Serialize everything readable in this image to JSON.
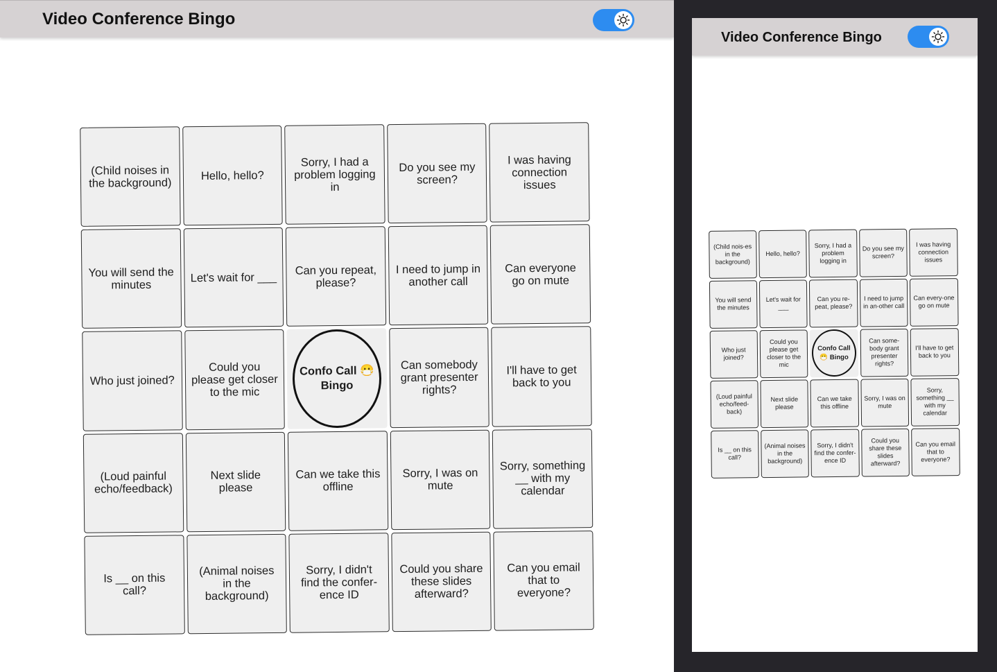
{
  "desktop": {
    "title": "Video Conference Bingo",
    "cells": [
      "(Child noises in the background)",
      "Hello, hello?",
      "Sorry, I had a problem logging in",
      "Do you see my screen?",
      "I was having connection issues",
      "You will send the minutes",
      "Let's wait for ___",
      "Can you repeat, please?",
      "I need to jump in another call",
      "Can everyone go on mute",
      "Who just joined?",
      "Could you please get closer to the mic",
      "Confo Call 😷 Bingo",
      "Can somebody grant presenter rights?",
      "I'll have to get back to you",
      "(Loud painful echo/feedback)",
      "Next slide please",
      "Can we take this offline",
      "Sorry, I was on mute",
      "Sorry, something __ with my calendar",
      "Is __ on this call?",
      "(Animal noises in the background)",
      "Sorry, I didn't find the confer-ence ID",
      "Could you share these slides afterward?",
      "Can you email that to everyone?"
    ]
  },
  "mobile": {
    "title": "Video Conference Bingo",
    "cells": [
      "(Child nois-es in the background)",
      "Hello, hello?",
      "Sorry, I had a problem logging in",
      "Do you see my screen?",
      "I was having connection issues",
      "You will send the minutes",
      "Let's wait for ___",
      "Can you re-peat, please?",
      "I need to jump in an-other call",
      "Can every-one go on mute",
      "Who just joined?",
      "Could you please get closer to the mic",
      "Confo Call 😷 Bingo",
      "Can some-body grant presenter rights?",
      "I'll have to get back to you",
      "(Loud painful echo/feed-back)",
      "Next slide please",
      "Can we take this offline",
      "Sorry, I was on mute",
      "Sorry, something __ with my calendar",
      "Is __ on this call?",
      "(Animal noises in the background)",
      "Sorry, I didn't find the confer-ence ID",
      "Could you share these slides afterward?",
      "Can you email that to everyone?"
    ]
  },
  "theme": {
    "toggle_color": "#2d8cf0",
    "header_color": "#d6d2d3",
    "card_color": "#efefef"
  },
  "icons": {
    "toggle": "sun-icon"
  }
}
